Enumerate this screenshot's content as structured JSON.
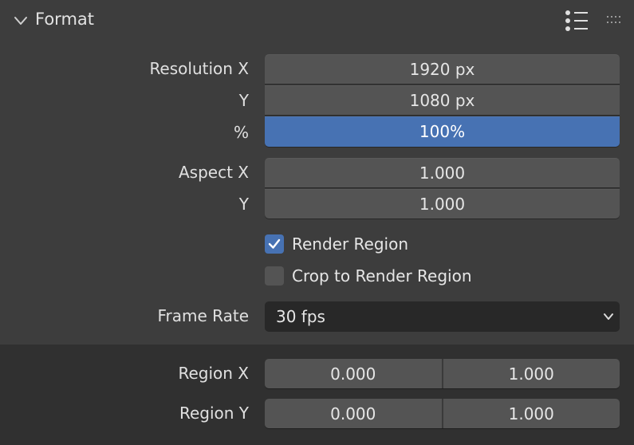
{
  "header": {
    "title": "Format",
    "icons": {
      "collapse": "chevron-down-icon",
      "presets": "list-icon",
      "drag": "drag-handle-icon"
    }
  },
  "resolution": {
    "x_label": "Resolution X",
    "x_value": "1920 px",
    "y_label": "Y",
    "y_value": "1080 px",
    "pct_label": "%",
    "pct_value": "100%"
  },
  "aspect": {
    "x_label": "Aspect X",
    "x_value": "1.000",
    "y_label": "Y",
    "y_value": "1.000"
  },
  "render_region": {
    "label": "Render Region",
    "checked": true
  },
  "crop_region": {
    "label": "Crop to Render Region",
    "checked": false
  },
  "frame_rate": {
    "label": "Frame Rate",
    "value": "30 fps"
  },
  "region": {
    "x_label": "Region X",
    "x_min": "0.000",
    "x_max": "1.000",
    "y_label": "Region Y",
    "y_min": "0.000",
    "y_max": "1.000"
  },
  "colors": {
    "panel_bg": "#3d3d3d",
    "field_bg": "#545454",
    "accent": "#4772b3",
    "dropdown_bg": "#282828"
  }
}
